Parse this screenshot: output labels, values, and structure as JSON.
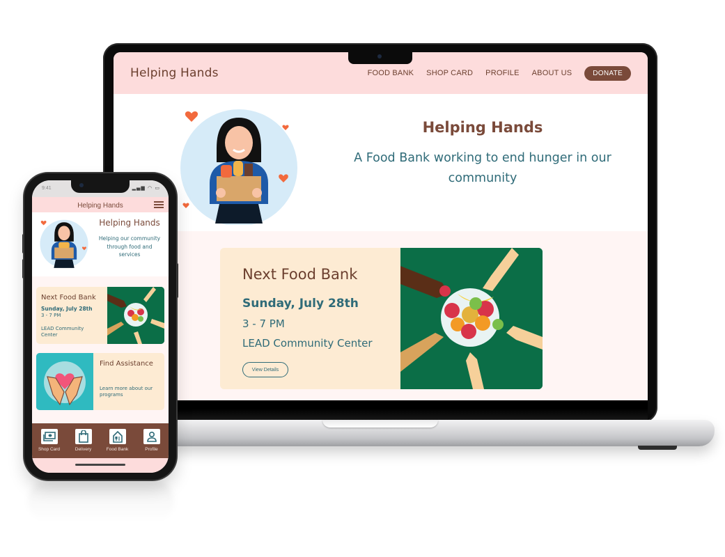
{
  "laptop": {
    "header": {
      "brand": "Helping Hands",
      "nav": [
        "FOOD BANK",
        "SHOP CARD",
        "PROFILE",
        "ABOUT US"
      ],
      "donate_label": "DONATE"
    },
    "hero": {
      "title": "Helping Hands",
      "subtitle": "A Food Bank working to end hunger in our community"
    },
    "event_card": {
      "title": "Next Food Bank",
      "date": "Sunday, July 28th",
      "time": "3 - 7 PM",
      "location": "LEAD Community Center",
      "button_label": "View Details"
    }
  },
  "phone": {
    "status_time": "9:41",
    "header_title": "Helping Hands",
    "hero": {
      "title": "Helping Hands",
      "subtitle": "Helping our community through food and services"
    },
    "event_card": {
      "title": "Next Food Bank",
      "date": "Sunday, July 28th",
      "time": "3 - 7 PM",
      "location": "LEAD Community Center"
    },
    "assistance_card": {
      "title": "Find Assistance",
      "subtitle": "Learn more about our programs"
    },
    "tabbar": [
      {
        "label": "Shop Card",
        "icon": "money-icon"
      },
      {
        "label": "Delivery",
        "icon": "shopping-bag-icon"
      },
      {
        "label": "Food Bank",
        "icon": "house-utensils-icon"
      },
      {
        "label": "Profile",
        "icon": "person-icon"
      }
    ]
  },
  "colors": {
    "header_pink": "#fddcdc",
    "brand_brown": "#7a4a3a",
    "text_teal": "#2f6b78",
    "card_cream": "#fdebd3",
    "art_green": "#0b6e47",
    "heart_orange": "#f26a3d",
    "assist_teal": "#2fbac0"
  }
}
